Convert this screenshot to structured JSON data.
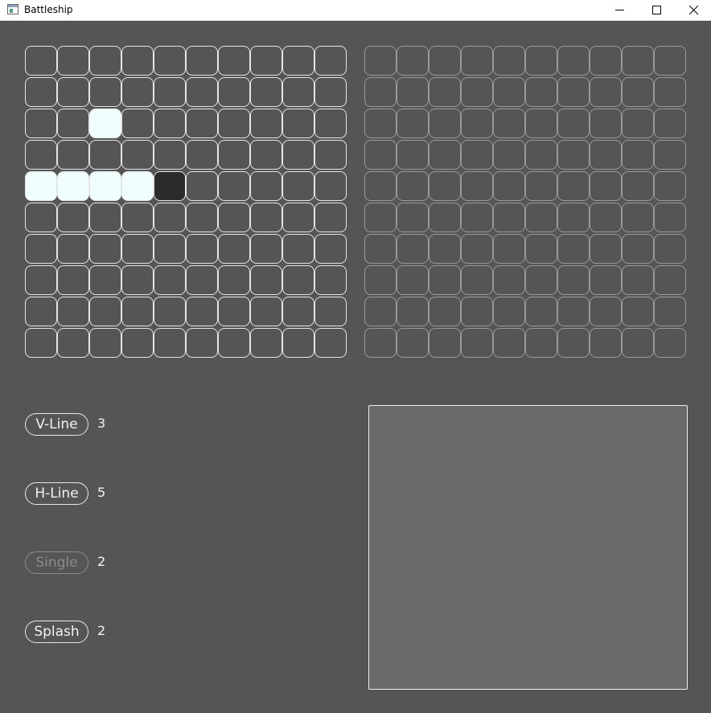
{
  "window": {
    "title": "Battleship",
    "controls": [
      "minimize-icon",
      "maximize-icon",
      "close-icon"
    ]
  },
  "player_grid": {
    "rows": 10,
    "cols": 10,
    "ship_cells": [
      [
        2,
        2
      ],
      [
        4,
        0
      ],
      [
        4,
        1
      ],
      [
        4,
        2
      ],
      [
        4,
        3
      ]
    ],
    "miss_cells": [
      [
        4,
        4
      ]
    ]
  },
  "enemy_grid": {
    "rows": 10,
    "cols": 10
  },
  "weapons": [
    {
      "label": "V-Line",
      "count": "3",
      "enabled": true
    },
    {
      "label": "H-Line",
      "count": "5",
      "enabled": true
    },
    {
      "label": "Single",
      "count": "2",
      "enabled": false
    },
    {
      "label": "Splash",
      "count": "2",
      "enabled": true
    }
  ],
  "colors": {
    "background": "#555555",
    "ship": "#f0fefe",
    "miss": "#2b2b2b",
    "panel": "#6a6a6a"
  }
}
